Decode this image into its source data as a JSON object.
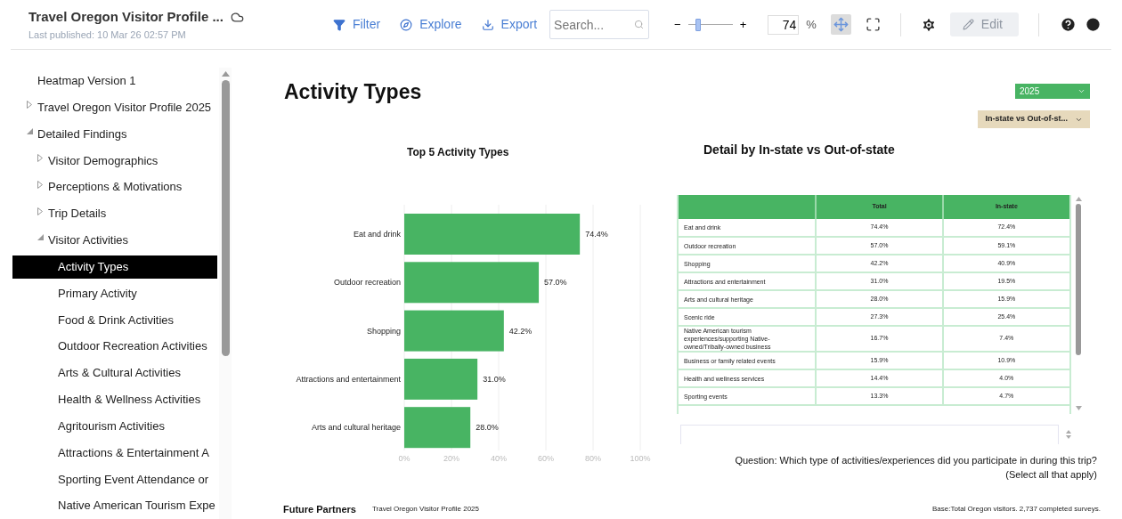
{
  "header": {
    "title": "Travel Oregon Visitor Profile ...",
    "subtitle": "Last published: 10 Mar 26 02:57 PM",
    "actions": [
      "Filter",
      "Explore",
      "Export"
    ],
    "search": {
      "placeholder": "Search..."
    },
    "zoom": {
      "minus": "−",
      "plus": "+",
      "level": 0.2,
      "value": "74",
      "unit": "%"
    },
    "fit_selected": true,
    "edit": {
      "label": "Edit",
      "disabled": true
    }
  },
  "sidebar": {
    "items": [
      {
        "label": "Heatmap Version 1",
        "selected": false
      },
      {
        "label": "Travel Oregon Visitor Profile 2025",
        "selected": false,
        "expanded": false
      },
      {
        "label": "Detailed Findings",
        "selected": false,
        "expanded": true,
        "children": [
          {
            "label": "Visitor Demographics",
            "selected": false,
            "expanded": false
          },
          {
            "label": "Perceptions & Motivations",
            "selected": false,
            "expanded": false
          },
          {
            "label": "Trip Details",
            "selected": false,
            "expanded": false
          },
          {
            "label": "Visitor Activities",
            "selected": false,
            "expanded": true,
            "children": [
              {
                "label": "Activity Types",
                "selected": true
              },
              {
                "label": "Primary Activity",
                "selected": false
              },
              {
                "label": "Food & Drink Activities",
                "selected": false
              },
              {
                "label": "Outdoor Recreation Activities",
                "selected": false
              },
              {
                "label": "Arts & Cultural Activities",
                "selected": false
              },
              {
                "label": "Health & Wellness Activities",
                "selected": false
              },
              {
                "label": "Agritourism Activities",
                "selected": false
              },
              {
                "label": "Attractions & Entertainment A",
                "selected": false
              },
              {
                "label": "Sporting Event Attendance or",
                "selected": false
              },
              {
                "label": "Native American Tourism Expe",
                "selected": false
              }
            ]
          }
        ]
      }
    ]
  },
  "page": {
    "title": "Activity Types",
    "year_dropdown": "2025",
    "segment_dropdown": "In-state vs Out-of-st...",
    "chart": {
      "title": "Top 5 Activity Types",
      "chart_data": {
        "type": "bar",
        "orientation": "horizontal",
        "categories": [
          "Eat and drink",
          "Outdoor recreation",
          "Shopping",
          "Attractions and entertainment",
          "Arts and cultural heritage"
        ],
        "grid": true,
        "series": [
          {
            "color": "#48b463",
            "values": [
              74.4,
              57.0,
              42.2,
              31.0,
              28.0
            ]
          }
        ],
        "value_labels": [
          "74.4%",
          "57.0%",
          "42.2%",
          "31.0%",
          "28.0%"
        ],
        "xlim": [
          0,
          100
        ],
        "xticks": [
          {
            "value": 0,
            "label": "0%"
          },
          {
            "value": 20,
            "label": "20%"
          },
          {
            "value": 40,
            "label": "40%"
          },
          {
            "value": 60,
            "label": "60%"
          },
          {
            "value": 80,
            "label": "80%"
          },
          {
            "value": 100,
            "label": "100%"
          }
        ]
      }
    },
    "table": {
      "title": "Detail by In-state vs Out-of-state",
      "columns": [
        "",
        "Total",
        "In-state"
      ],
      "rows": [
        [
          "Eat and drink",
          "74.4%",
          "72.4%"
        ],
        [
          "Outdoor recreation",
          "57.0%",
          "59.1%"
        ],
        [
          "Shopping",
          "42.2%",
          "40.9%"
        ],
        [
          "Attractions and entertainment",
          "31.0%",
          "19.5%"
        ],
        [
          "Arts and cultural heritage",
          "28.0%",
          "15.9%"
        ],
        [
          "Scenic ride",
          "27.3%",
          "25.4%"
        ],
        [
          "Native American tourism experiences/supporting Native-owned/Tribally-owned business",
          "16.7%",
          "7.4%"
        ],
        [
          "Business or family related events",
          "15.9%",
          "10.9%"
        ],
        [
          "Health and wellness services",
          "14.4%",
          "4.0%"
        ],
        [
          "Sporting events",
          "13.3%",
          "4.7%"
        ]
      ]
    },
    "question": [
      "Question: Which type of activities/experiences did you participate in during this trip?",
      "(Select all that apply)"
    ],
    "footer": {
      "brand": "Future Partners",
      "report": "Travel Oregon Visitor Profile 2025",
      "base": "Base:Total Oregon visitors. 2,737 completed surveys."
    }
  }
}
